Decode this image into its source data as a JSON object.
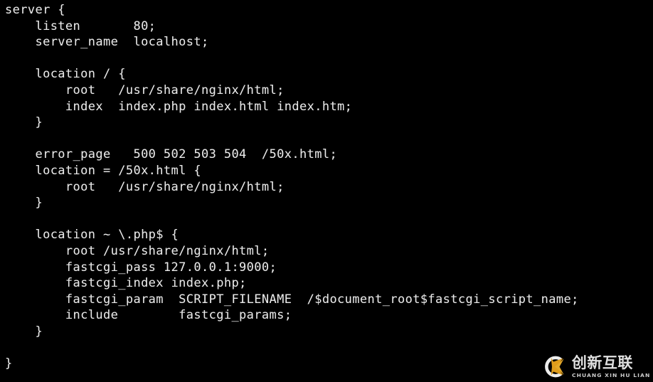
{
  "terminal": {
    "background_color": "#000000",
    "text_color": "#e9e9e9",
    "code": "server {\n    listen       80;\n    server_name  localhost;\n\n    location / {\n        root   /usr/share/nginx/html;\n        index  index.php index.html index.htm;\n    }\n\n    error_page   500 502 503 504  /50x.html;\n    location = /50x.html {\n        root   /usr/share/nginx/html;\n    }\n\n    location ~ \\.php$ {\n        root /usr/share/nginx/html;\n        fastcgi_pass 127.0.0.1:9000;\n        fastcgi_index index.php;\n        fastcgi_param  SCRIPT_FILENAME  /$document_root$fastcgi_script_name;\n        include        fastcgi_params;\n    }\n\n}",
    "lines": [
      "server {",
      "    listen       80;",
      "    server_name  localhost;",
      "",
      "    location / {",
      "        root   /usr/share/nginx/html;",
      "        index  index.php index.html index.htm;",
      "    }",
      "",
      "    error_page   500 502 503 504  /50x.html;",
      "    location = /50x.html {",
      "        root   /usr/share/nginx/html;",
      "    }",
      "",
      "    location ~ \\.php$ {",
      "        root /usr/share/nginx/html;",
      "        fastcgi_pass 127.0.0.1:9000;",
      "        fastcgi_index index.php;",
      "        fastcgi_param  SCRIPT_FILENAME  /$document_root$fastcgi_script_name;",
      "        include        fastcgi_params;",
      "    }",
      "",
      "}"
    ]
  },
  "watermark": {
    "logo_icon": "cx-circle-logo-icon",
    "brand_cn": "创新互联",
    "brand_pinyin": "CHUANG XIN HU LIAN",
    "ring_color": "#ffffff",
    "accent_color": "#f0a81e"
  }
}
